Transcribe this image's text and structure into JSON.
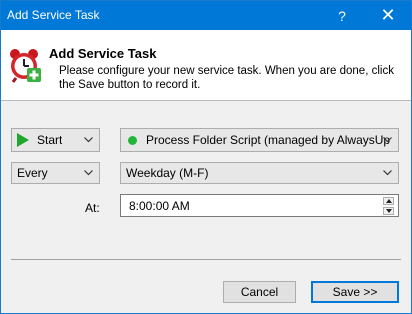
{
  "window": {
    "title": "Add Service Task",
    "help_label": "?",
    "close_label": "✕"
  },
  "header": {
    "heading": "Add Service Task",
    "description": "Please configure your new service task. When you are done, click the Save button to record it.",
    "icon": "alarm-clock-add-icon"
  },
  "form": {
    "action": {
      "value": "Start",
      "icon": "play-icon",
      "icon_color": "#22a72e"
    },
    "service": {
      "value": "Process Folder Script (managed by AlwaysUpService)",
      "icon": "status-dot-icon",
      "icon_color": "#23b53a"
    },
    "frequency": {
      "value": "Every"
    },
    "schedule": {
      "value": "Weekday (M-F)"
    },
    "time": {
      "label": "At:",
      "value": "8:00:00 AM"
    }
  },
  "buttons": {
    "cancel": "Cancel",
    "save": "Save >>"
  },
  "colors": {
    "titlebar": "#0078d7",
    "accent": "#0078d7"
  }
}
